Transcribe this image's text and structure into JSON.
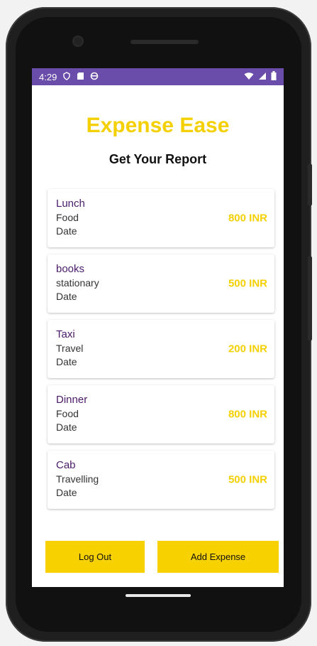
{
  "status": {
    "time": "4:29",
    "icons_left": [
      "shield-icon",
      "sd-card-icon",
      "circle-icon"
    ],
    "icons_right": [
      "wifi-icon",
      "signal-icon",
      "battery-icon"
    ]
  },
  "header": {
    "title": "Expense Ease",
    "subtitle": "Get Your Report"
  },
  "expenses": [
    {
      "name": "Lunch",
      "category": "Food",
      "date": "Date",
      "amount": "800 INR"
    },
    {
      "name": "books",
      "category": "stationary",
      "date": "Date",
      "amount": "500 INR"
    },
    {
      "name": "Taxi",
      "category": "Travel",
      "date": "Date",
      "amount": "200 INR"
    },
    {
      "name": "Dinner",
      "category": "Food",
      "date": "Date",
      "amount": "800 INR"
    },
    {
      "name": "Cab",
      "category": "Travelling",
      "date": "Date",
      "amount": "500 INR"
    }
  ],
  "actions": {
    "logout_label": "Log Out",
    "add_label": "Add Expense"
  },
  "colors": {
    "accent": "#f5d000",
    "statusbar": "#6a4cab",
    "expense_name": "#4a1a6a"
  }
}
